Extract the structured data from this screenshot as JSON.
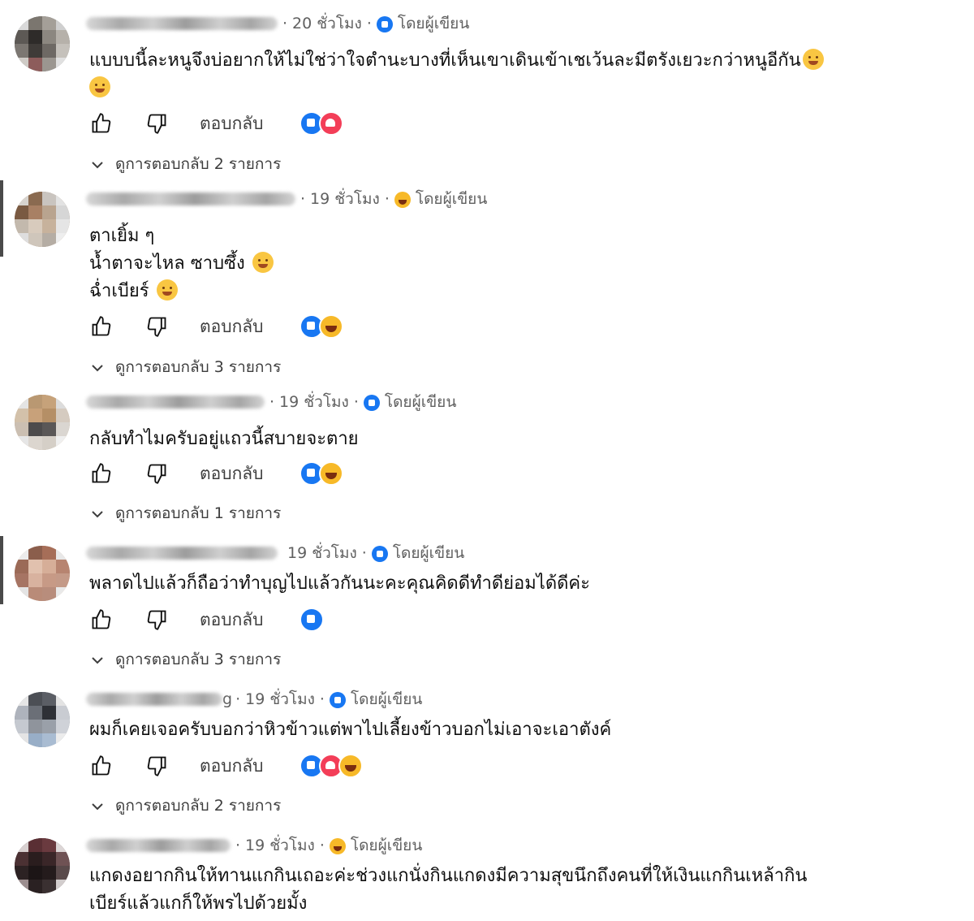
{
  "author_badge_label": "โดยผู้เขียน",
  "reply_label": "ตอบกลับ",
  "comments": [
    {
      "time": "20 ชั่วโมง",
      "badge": "blue",
      "lines": [
        "แบบบนี้ละหนูจึงบ่อยากให้ไม่ใช่ว่าใจตำนะบางที่เห็นเขาเดินเข้าเชเว้นละมีตรังเยวะกว่าหนูอีกัน"
      ],
      "reactions": [
        "like",
        "love"
      ],
      "replies_label": "ดูการตอบกลับ 2 รายการ"
    },
    {
      "time": "19 ชั่วโมง",
      "badge": "emoji",
      "lines": [
        "ตาเยิ้ม ๆ",
        "น้ำตาจะไหล ซาบซึ้ง",
        "ฉ่ำเบียร์"
      ],
      "reactions": [
        "like",
        "haha"
      ],
      "replies_label": "ดูการตอบกลับ 3 รายการ"
    },
    {
      "time": "19 ชั่วโมง",
      "badge": "blue",
      "lines": [
        "กลับทำไมครับอยู่แถวนี้สบายจะตาย"
      ],
      "reactions": [
        "like",
        "haha"
      ],
      "replies_label": "ดูการตอบกลับ 1 รายการ"
    },
    {
      "time": "19 ชั่วโมง",
      "badge": "blue",
      "lines": [
        "พลาดไปแล้วก็ถือว่าทำบุญไปแล้วกันนะคะคุณคิดดีทำดีย่อมได้ดีค่ะ"
      ],
      "reactions": [
        "like"
      ],
      "replies_label": "ดูการตอบกลับ 3 รายการ"
    },
    {
      "time": "19 ชั่วโมง",
      "name_suffix": "g",
      "badge": "blue",
      "lines": [
        "ผมก็เคยเจอครับบอกว่าหิวข้าวแต่พาไปเลี้ยงข้าวบอกไม่เอาจะเอาตังค์"
      ],
      "reactions": [
        "like",
        "love",
        "haha"
      ],
      "replies_label": "ดูการตอบกลับ 2 รายการ"
    },
    {
      "time": "19 ชั่วโมง",
      "badge": "emoji",
      "lines": [
        "แกดงอยากกินให้ทานแกกินเถอะค่ะช่วงแกนั่งกินแกดงมีความสุขนึกถึงคนที่ให้เงินแกกินเหล้ากิน",
        "เบียร์แล้วแกก็ให้พรไปด้วยมั้ง"
      ]
    }
  ]
}
